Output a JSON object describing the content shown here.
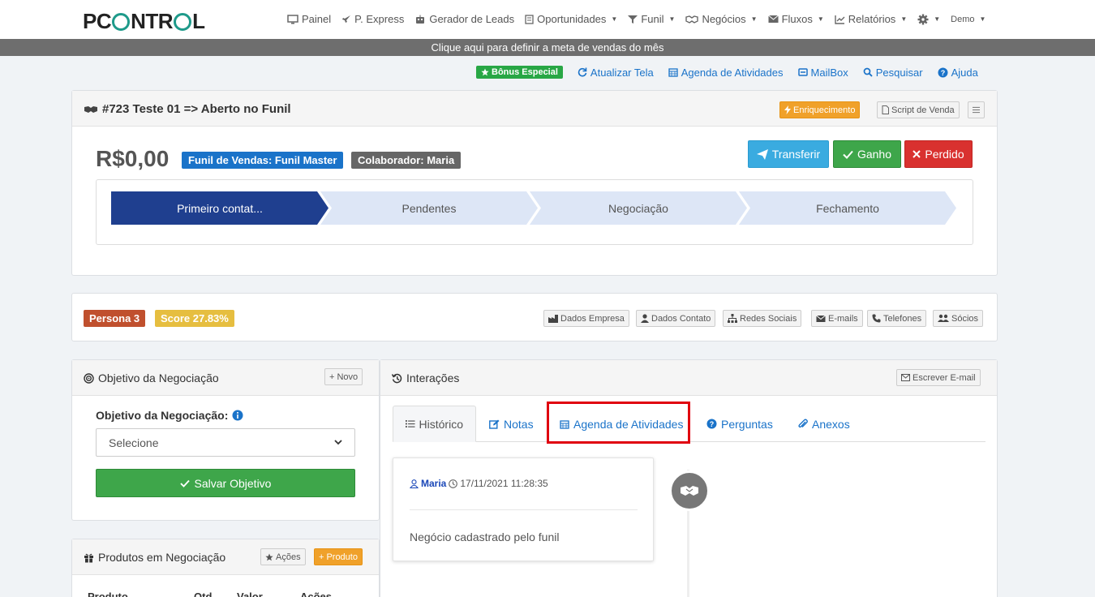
{
  "brand": {
    "logo_left": "PC",
    "logo_mid": "NTR",
    "logo_right": "L"
  },
  "nav": {
    "items": [
      {
        "label": "Painel",
        "caret": false
      },
      {
        "label": "P. Express",
        "caret": false
      },
      {
        "label": "Gerador de Leads",
        "caret": false
      },
      {
        "label": "Oportunidades",
        "caret": true
      },
      {
        "label": "Funil",
        "caret": true
      },
      {
        "label": "Negócios",
        "caret": true
      },
      {
        "label": "Fluxos",
        "caret": true
      },
      {
        "label": "Relatórios",
        "caret": true
      }
    ],
    "user": "Demo"
  },
  "banner": {
    "text": "Clique aqui para definir a meta de vendas do mês"
  },
  "toolbar": {
    "bonus": "Bônus Especial",
    "refresh": "Atualizar Tela",
    "agenda": "Agenda de Atividades",
    "mailbox": "MailBox",
    "search": "Pesquisar",
    "help": "Ajuda"
  },
  "deal": {
    "title": "#723 Teste 01 => Aberto no Funil",
    "enrich": "Enriquecimento",
    "script": "Script de Venda",
    "value": "R$0,00",
    "funnel_label": "Funil de Vendas: Funil Master",
    "collaborator_label": "Colaborador: Maria",
    "transfer": "Transferir",
    "won": "Ganho",
    "lost": "Perdido",
    "stages": [
      "Primeiro contat...",
      "Pendentes",
      "Negociação",
      "Fechamento"
    ],
    "active_stage": 0
  },
  "persona": {
    "persona": "Persona 3",
    "score": "Score 27.83%",
    "buttons": [
      "Dados Empresa",
      "Dados Contato",
      "Redes Sociais",
      "E-mails",
      "Telefones",
      "Sócios"
    ]
  },
  "objective": {
    "title": "Objetivo da Negociação",
    "new": "Novo",
    "field_label": "Objetivo da Negociação:",
    "select_value": "Selecione",
    "save": "Salvar Objetivo"
  },
  "interactions": {
    "title": "Interações",
    "write_email": "Escrever E-mail",
    "tabs": [
      "Histórico",
      "Notas",
      "Agenda de Atividades",
      "Perguntas",
      "Anexos"
    ],
    "entry": {
      "user": "Maria",
      "datetime": "17/11/2021 11:28:35",
      "text": "Negócio cadastrado pelo funil"
    }
  },
  "products": {
    "title": "Produtos em Negociação",
    "actions": "Ações",
    "add": "Produto",
    "columns": [
      "Produto",
      "Qtd",
      "Valor",
      "Ações"
    ]
  },
  "colors": {
    "primary": "#1a73c9",
    "active_stage": "#1f3f8f",
    "stage": "#dde6f6",
    "won": "#3ea64a",
    "lost": "#d9312f",
    "transfer": "#3aabe0",
    "highlight": "#e0000f"
  }
}
